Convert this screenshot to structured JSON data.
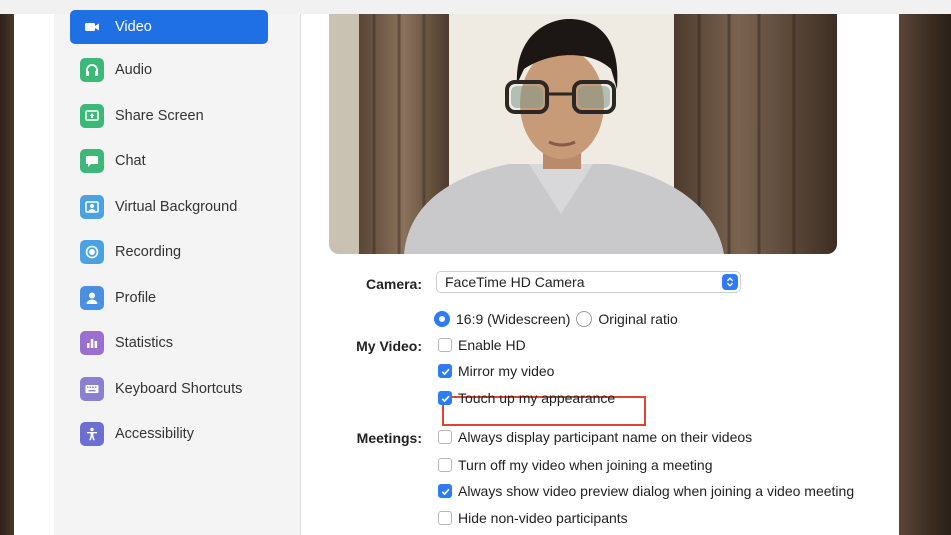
{
  "sidebar": {
    "items": [
      {
        "label": "Video",
        "icon": "video-camera-icon",
        "color": "#ffffff",
        "active": true
      },
      {
        "label": "Audio",
        "icon": "headphones-icon",
        "color": "#3cb878"
      },
      {
        "label": "Share Screen",
        "icon": "share-screen-icon",
        "color": "#3cb878"
      },
      {
        "label": "Chat",
        "icon": "chat-bubble-icon",
        "color": "#3cb878"
      },
      {
        "label": "Virtual Background",
        "icon": "virtual-background-icon",
        "color": "#4aa3e0"
      },
      {
        "label": "Recording",
        "icon": "record-icon",
        "color": "#4aa3e0"
      },
      {
        "label": "Profile",
        "icon": "profile-icon",
        "color": "#4a8fe0"
      },
      {
        "label": "Statistics",
        "icon": "statistics-icon",
        "color": "#9b6fd0"
      },
      {
        "label": "Keyboard Shortcuts",
        "icon": "keyboard-icon",
        "color": "#8a7fd0"
      },
      {
        "label": "Accessibility",
        "icon": "accessibility-icon",
        "color": "#6a6fd0"
      }
    ]
  },
  "camera": {
    "label": "Camera:",
    "value": "FaceTime HD Camera"
  },
  "my_video": {
    "label": "My Video:",
    "ratio_widescreen": "16:9 (Widescreen)",
    "ratio_original": "Original ratio",
    "enable_hd": "Enable HD",
    "mirror": "Mirror my video",
    "touch_up": "Touch up my appearance"
  },
  "meetings": {
    "label": "Meetings:",
    "display_name": "Always display participant name on their videos",
    "turn_off": "Turn off my video when joining a meeting",
    "show_preview": "Always show video preview dialog when joining a video meeting",
    "hide_non_video": "Hide non-video participants"
  },
  "states": {
    "widescreen": true,
    "enable_hd": false,
    "mirror": true,
    "touch_up": true,
    "display_name": false,
    "turn_off": false,
    "show_preview": true,
    "hide_non_video": false
  },
  "colors": {
    "accent": "#1f6fe5",
    "checkbox": "#2f7bf6",
    "highlight": "#e0452a"
  }
}
